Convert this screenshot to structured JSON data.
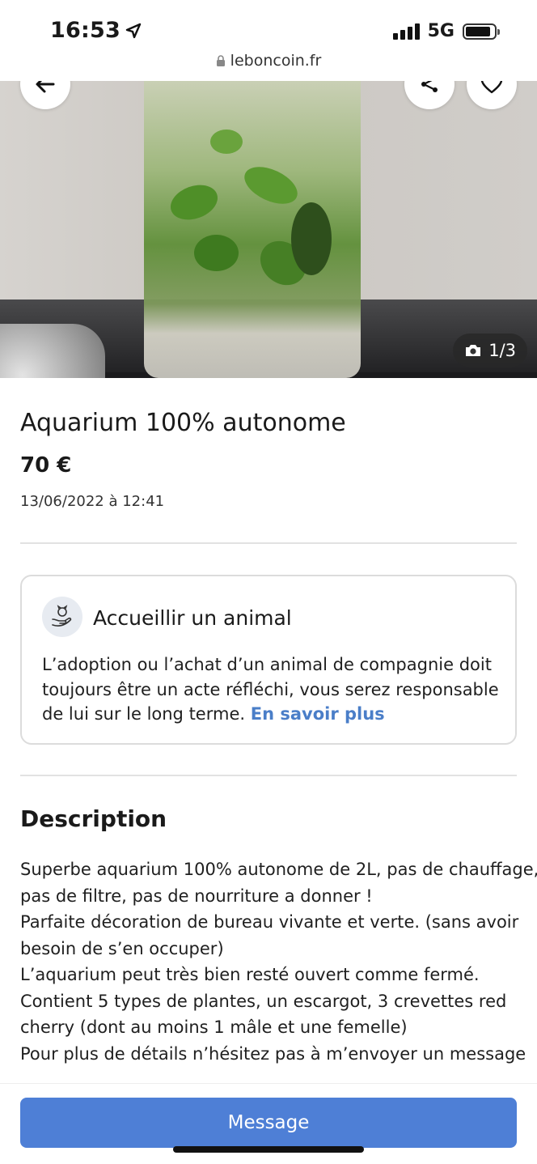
{
  "status_bar": {
    "time": "16:53",
    "network": "5G",
    "url": "leboncoin.fr"
  },
  "gallery": {
    "counter": "1/3"
  },
  "listing": {
    "title": "Aquarium 100% autonome",
    "price": "70 €",
    "date": "13/06/2022 à 12:41"
  },
  "notice_card": {
    "title": "Accueillir un animal",
    "body": "L’adoption ou l’achat d’un animal de compagnie doit toujours être un acte réfléchi, vous serez responsable de lui sur le long terme.",
    "link": "En savoir plus"
  },
  "description": {
    "heading": "Description",
    "lines": [
      "Superbe aquarium 100% autonome de 2L, pas de chauffage,",
      "pas de filtre, pas de nourriture a donner !",
      "Parfaite décoration de bureau vivante et verte. (sans avoir",
      "besoin de s’en occuper)",
      "L’aquarium peut très bien resté ouvert comme fermé.",
      "Contient 5 types de plantes, un escargot, 3 crevettes red",
      "cherry (dont au moins 1 mâle et une femelle)",
      "Pour plus de détails n’hésitez pas à m’envoyer un message"
    ]
  },
  "actions": {
    "message_button": "Message"
  },
  "icons": {
    "back": "arrow-left-icon",
    "share": "share-icon",
    "favorite": "heart-icon",
    "camera": "camera-icon",
    "animal": "animal-hand-icon",
    "lock": "lock-icon",
    "location": "location-arrow-icon"
  },
  "colors": {
    "accent": "#4e7fd6",
    "link": "#4a7ec8"
  }
}
